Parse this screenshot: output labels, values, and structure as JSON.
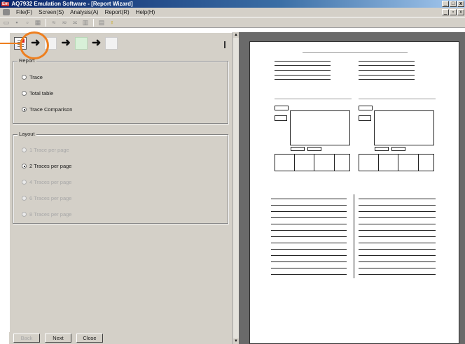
{
  "window": {
    "app_badge": "Em",
    "title": "AQ7932 Emulation Software - [Report Wizard]",
    "controls": [
      "_",
      "□",
      "x"
    ],
    "child_controls": [
      "_",
      "▫",
      "x"
    ]
  },
  "menu": {
    "items": [
      "File(F)",
      "Screen(S)",
      "Analysis(A)",
      "Report(R)",
      "Help(H)"
    ]
  },
  "wizard": {
    "report_group": {
      "title": "Report",
      "options": [
        {
          "label": "Trace",
          "checked": false
        },
        {
          "label": "Total table",
          "checked": false
        },
        {
          "label": "Trace Comparison",
          "checked": true
        }
      ]
    },
    "layout_group": {
      "title": "Layout",
      "options": [
        {
          "label": "1 Trace per page",
          "checked": false,
          "enabled": false
        },
        {
          "label": "2 Traces per page",
          "checked": true,
          "enabled": true
        },
        {
          "label": "4 Traces per page",
          "checked": false,
          "enabled": false
        },
        {
          "label": "6 Traces per page",
          "checked": false,
          "enabled": false
        },
        {
          "label": "8 Traces per page",
          "checked": false,
          "enabled": false
        }
      ]
    },
    "buttons": {
      "back": "Back",
      "next": "Next",
      "close": "Close"
    }
  },
  "icons": {
    "highlight_color": "#ee7f1f",
    "step_arrow": "right-arrow-icon"
  },
  "scroll": {
    "up": "▲",
    "down": "▼"
  }
}
